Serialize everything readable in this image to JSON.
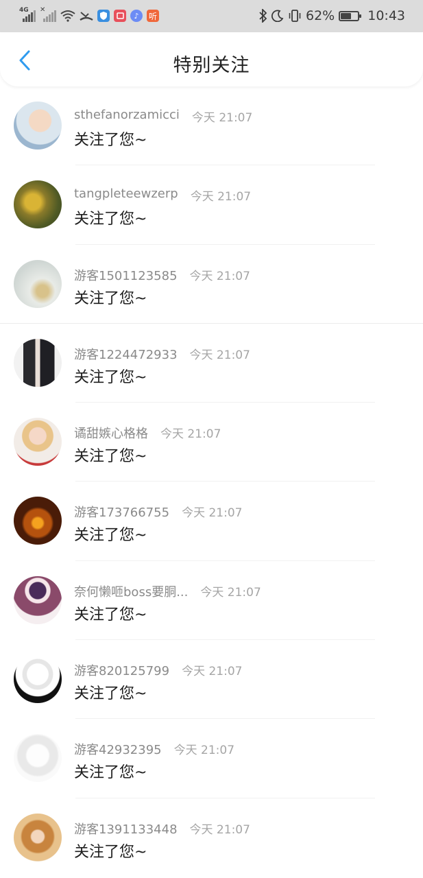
{
  "status_bar": {
    "network": "4G",
    "battery": "62%",
    "battery_level": 0.62,
    "time": "10:43",
    "app_icon_text": "听"
  },
  "header": {
    "title": "特别关注"
  },
  "notifications": [
    {
      "name": "sthefanorzamicci",
      "time": "今天 21:07",
      "message": "关注了您~"
    },
    {
      "name": "tangpleteewzerp",
      "time": "今天 21:07",
      "message": "关注了您~"
    },
    {
      "name": "游客1501123585",
      "time": "今天 21:07",
      "message": "关注了您~"
    },
    {
      "name": "游客1224472933",
      "time": "今天 21:07",
      "message": "关注了您~"
    },
    {
      "name": "谲甜嫉心格格",
      "time": "今天 21:07",
      "message": "关注了您~"
    },
    {
      "name": "游客173766755",
      "time": "今天 21:07",
      "message": "关注了您~"
    },
    {
      "name": "奈何懒咂boss要胴...",
      "time": "今天 21:07",
      "message": "关注了您~"
    },
    {
      "name": "游客820125799",
      "time": "今天 21:07",
      "message": "关注了您~"
    },
    {
      "name": "游客42932395",
      "time": "今天 21:07",
      "message": "关注了您~"
    },
    {
      "name": "游客1391133448",
      "time": "今天 21:07",
      "message": "关注了您~"
    }
  ],
  "colors": {
    "accent": "#2f9bef",
    "status_bar_bg": "#dcdcdc",
    "name_text": "#8a8a8a",
    "message_text": "#1e1e1e"
  }
}
